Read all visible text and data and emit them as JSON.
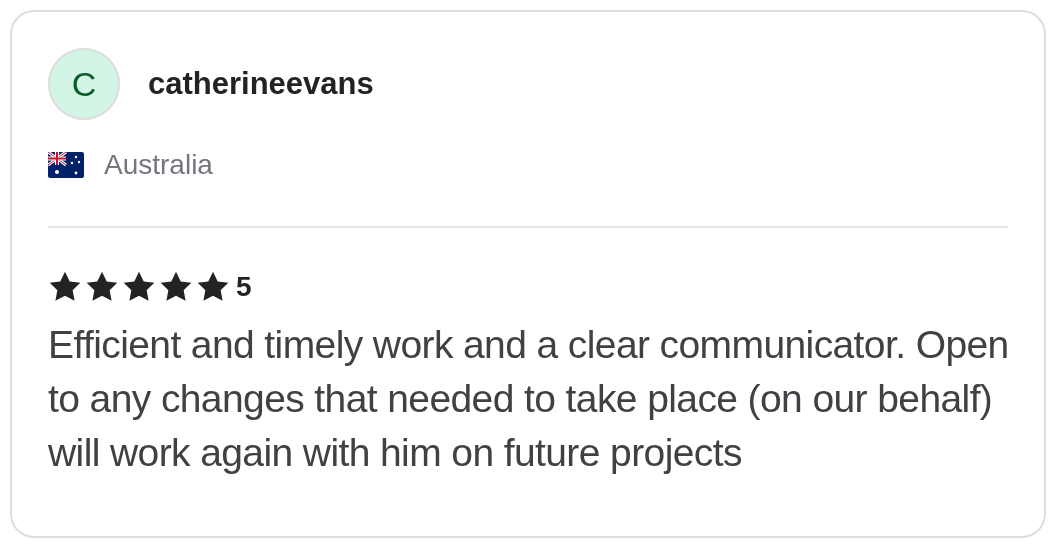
{
  "reviewer": {
    "initial": "C",
    "name": "catherineevans",
    "country": "Australia"
  },
  "rating": {
    "stars": 5,
    "value": "5"
  },
  "review": "Efficient and timely work and a clear communicator. Open to any changes that needed to take place (on our behalf) will work again with him on future projects"
}
